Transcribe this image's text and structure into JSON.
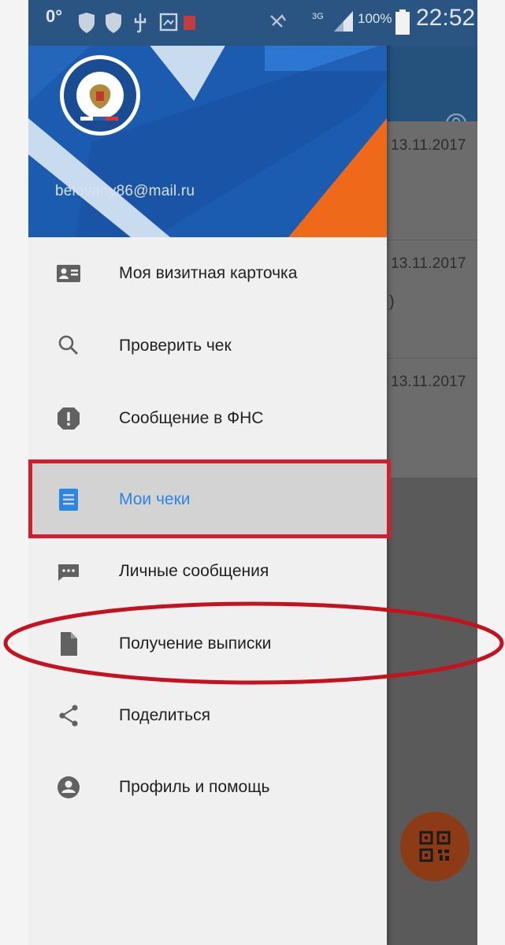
{
  "status_bar": {
    "left_text": "0°",
    "network": "3G",
    "battery": "100%",
    "time": "22:52"
  },
  "drawer": {
    "email": "belovany86@mail.ru",
    "menu": [
      {
        "label": "Моя визитная карточка",
        "icon": "contact-card-icon",
        "active": false
      },
      {
        "label": "Проверить чек",
        "icon": "search-icon",
        "active": false
      },
      {
        "label": "Сообщение в ФНС",
        "icon": "alert-icon",
        "active": false
      },
      {
        "label": "Мои чеки",
        "icon": "document-icon",
        "active": true
      },
      {
        "label": "Личные сообщения",
        "icon": "chat-icon",
        "active": false
      },
      {
        "label": "Получение выписки",
        "icon": "file-icon",
        "active": false
      },
      {
        "label": "Поделиться",
        "icon": "share-icon",
        "active": false
      },
      {
        "label": "Профиль и помощь",
        "icon": "account-icon",
        "active": false
      }
    ]
  },
  "background_list": {
    "rows": [
      {
        "date": "13.11.2017"
      },
      {
        "date": "13.11.2017"
      },
      {
        "date": "13.11.2017"
      }
    ],
    "stray_text": ")"
  },
  "colors": {
    "header_blue": "#1c5cb0",
    "accent_orange": "#ee6a1a",
    "active_blue": "#2a86e2",
    "annotation_red": "#c4121f"
  }
}
